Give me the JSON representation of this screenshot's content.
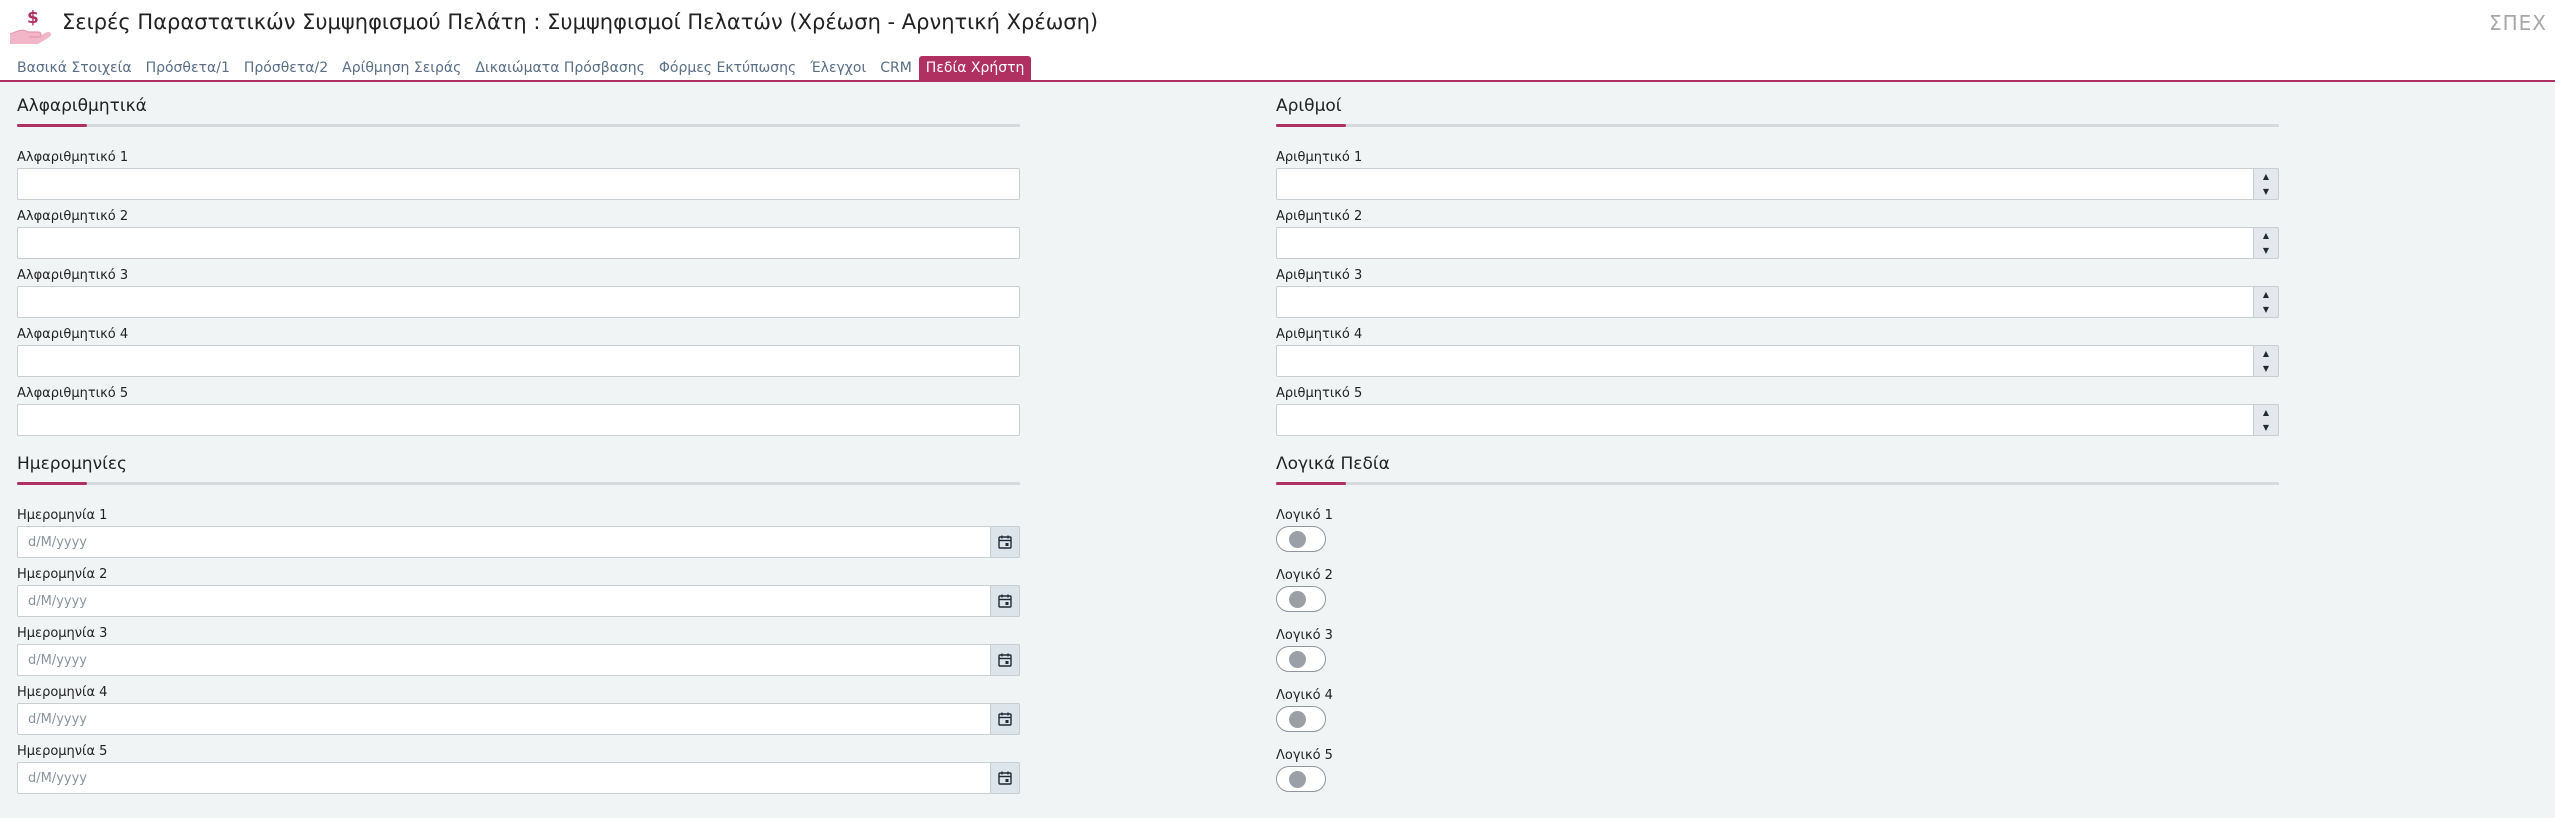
{
  "header": {
    "title": "Σειρές Παραστατικών Συμψηφισμού Πελάτη : Συμψηφισμοί Πελατών (Χρέωση - Αρνητική Χρέωση)",
    "company": "ΣΠΕΧ",
    "icon": "hand-dollar-icon"
  },
  "tabs": [
    {
      "label": "Βασικά Στοιχεία"
    },
    {
      "label": "Πρόσθετα/1"
    },
    {
      "label": "Πρόσθετα/2"
    },
    {
      "label": "Αρίθμηση Σειράς"
    },
    {
      "label": "Δικαιώματα Πρόσβασης"
    },
    {
      "label": "Φόρμες Εκτύπωσης"
    },
    {
      "label": "Έλεγχοι"
    },
    {
      "label": "CRM"
    },
    {
      "label": "Πεδία Χρήστη",
      "active": true
    }
  ],
  "accent_color": "#b03062",
  "sections": {
    "alpha": {
      "title": "Αλφαριθμητικά",
      "fields": [
        {
          "label": "Αλφαριθμητικό 1",
          "value": ""
        },
        {
          "label": "Αλφαριθμητικό 2",
          "value": ""
        },
        {
          "label": "Αλφαριθμητικό 3",
          "value": ""
        },
        {
          "label": "Αλφαριθμητικό 4",
          "value": ""
        },
        {
          "label": "Αλφαριθμητικό 5",
          "value": ""
        }
      ]
    },
    "numbers": {
      "title": "Αριθμοί",
      "fields": [
        {
          "label": "Αριθμητικό 1",
          "value": ""
        },
        {
          "label": "Αριθμητικό 2",
          "value": ""
        },
        {
          "label": "Αριθμητικό 3",
          "value": ""
        },
        {
          "label": "Αριθμητικό 4",
          "value": ""
        },
        {
          "label": "Αριθμητικό 5",
          "value": ""
        }
      ]
    },
    "dates": {
      "title": "Ημερομηνίες",
      "placeholder": "d/M/yyyy",
      "fields": [
        {
          "label": "Ημερομηνία 1",
          "value": ""
        },
        {
          "label": "Ημερομηνία 2",
          "value": ""
        },
        {
          "label": "Ημερομηνία 3",
          "value": ""
        },
        {
          "label": "Ημερομηνία 4",
          "value": ""
        },
        {
          "label": "Ημερομηνία 5",
          "value": ""
        }
      ]
    },
    "logical": {
      "title": "Λογικά Πεδία",
      "fields": [
        {
          "label": "Λογικό 1",
          "checked": false
        },
        {
          "label": "Λογικό 2",
          "checked": false
        },
        {
          "label": "Λογικό 3",
          "checked": false
        },
        {
          "label": "Λογικό 4",
          "checked": false
        },
        {
          "label": "Λογικό 5",
          "checked": false
        }
      ]
    }
  }
}
